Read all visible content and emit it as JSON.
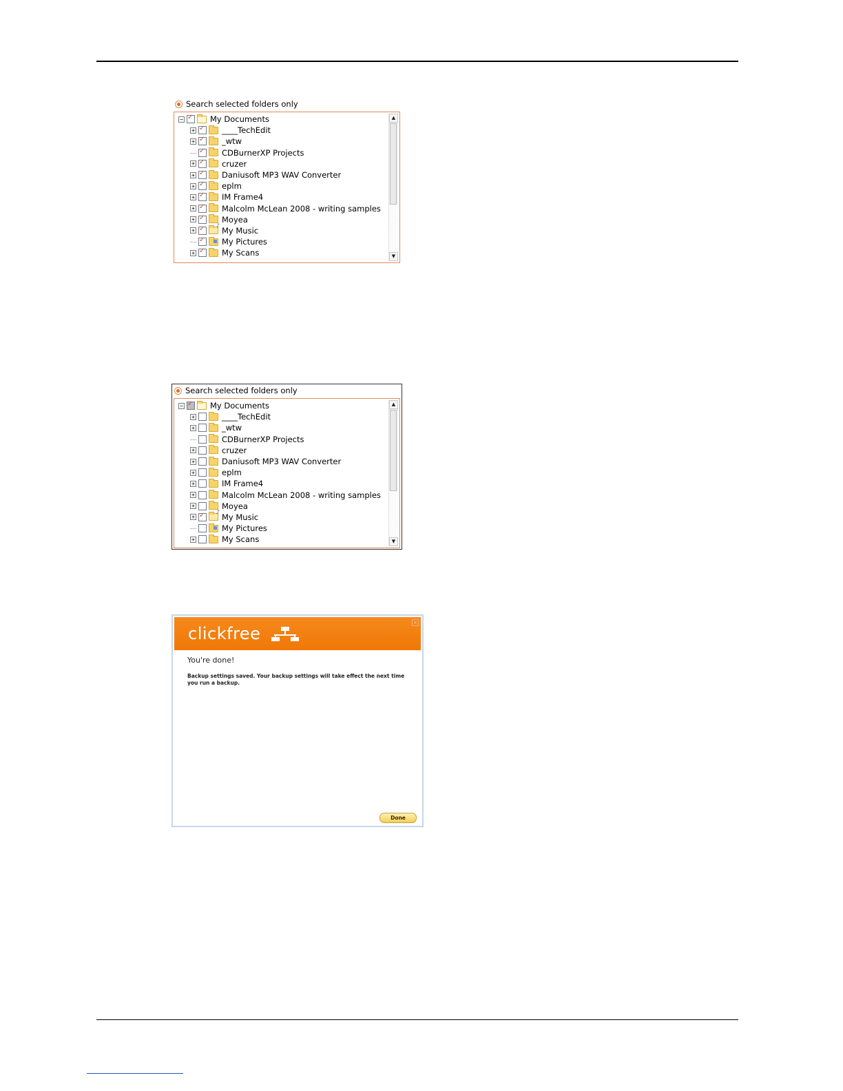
{
  "panels": [
    {
      "radio_label": "Search selected folders only",
      "root": {
        "label": "My Documents",
        "checked": true
      },
      "items": [
        {
          "label": "____TechEdit",
          "checked": true,
          "expandable": true,
          "icon": "folder-icon"
        },
        {
          "label": "_wtw",
          "checked": true,
          "expandable": true,
          "icon": "folder-icon"
        },
        {
          "label": "CDBurnerXP Projects",
          "checked": true,
          "expandable": false,
          "icon": "folder-icon"
        },
        {
          "label": "cruzer",
          "checked": true,
          "expandable": true,
          "icon": "folder-icon"
        },
        {
          "label": "Daniusoft MP3 WAV Converter",
          "checked": true,
          "expandable": true,
          "icon": "folder-icon"
        },
        {
          "label": "eplm",
          "checked": true,
          "expandable": true,
          "icon": "folder-icon"
        },
        {
          "label": "IM Frame4",
          "checked": true,
          "expandable": true,
          "icon": "folder-icon"
        },
        {
          "label": "Malcolm McLean 2008 - writing samples",
          "checked": true,
          "expandable": true,
          "icon": "folder-icon"
        },
        {
          "label": "Moyea",
          "checked": true,
          "expandable": true,
          "icon": "folder-icon"
        },
        {
          "label": "My Music",
          "checked": true,
          "expandable": true,
          "icon": "music-folder-icon"
        },
        {
          "label": "My Pictures",
          "checked": true,
          "expandable": false,
          "icon": "pictures-folder-icon"
        },
        {
          "label": "My Scans",
          "checked": true,
          "expandable": true,
          "icon": "folder-icon"
        }
      ]
    },
    {
      "radio_label": "Search selected folders only",
      "root": {
        "label": "My Documents",
        "checked": true
      },
      "items": [
        {
          "label": "____TechEdit",
          "checked": false,
          "expandable": true,
          "icon": "folder-icon"
        },
        {
          "label": "_wtw",
          "checked": false,
          "expandable": true,
          "icon": "folder-icon"
        },
        {
          "label": "CDBurnerXP Projects",
          "checked": false,
          "expandable": false,
          "icon": "folder-icon"
        },
        {
          "label": "cruzer",
          "checked": false,
          "expandable": true,
          "icon": "folder-icon"
        },
        {
          "label": "Daniusoft MP3 WAV Converter",
          "checked": false,
          "expandable": true,
          "icon": "folder-icon"
        },
        {
          "label": "eplm",
          "checked": false,
          "expandable": true,
          "icon": "folder-icon"
        },
        {
          "label": "IM Frame4",
          "checked": false,
          "expandable": true,
          "icon": "folder-icon"
        },
        {
          "label": "Malcolm McLean 2008 - writing samples",
          "checked": false,
          "expandable": true,
          "icon": "folder-icon"
        },
        {
          "label": "Moyea",
          "checked": false,
          "expandable": true,
          "icon": "folder-icon"
        },
        {
          "label": "My Music",
          "checked": true,
          "expandable": true,
          "icon": "music-folder-icon"
        },
        {
          "label": "My Pictures",
          "checked": false,
          "expandable": false,
          "icon": "pictures-folder-icon"
        },
        {
          "label": "My Scans",
          "checked": false,
          "expandable": true,
          "icon": "folder-icon"
        }
      ]
    }
  ],
  "dialog": {
    "brand": "clickfree",
    "heading": "You're done!",
    "message": "Backup settings saved. Your backup settings will take effect the next time you run a backup.",
    "done_label": "Done",
    "accent_color": "#f07808"
  }
}
